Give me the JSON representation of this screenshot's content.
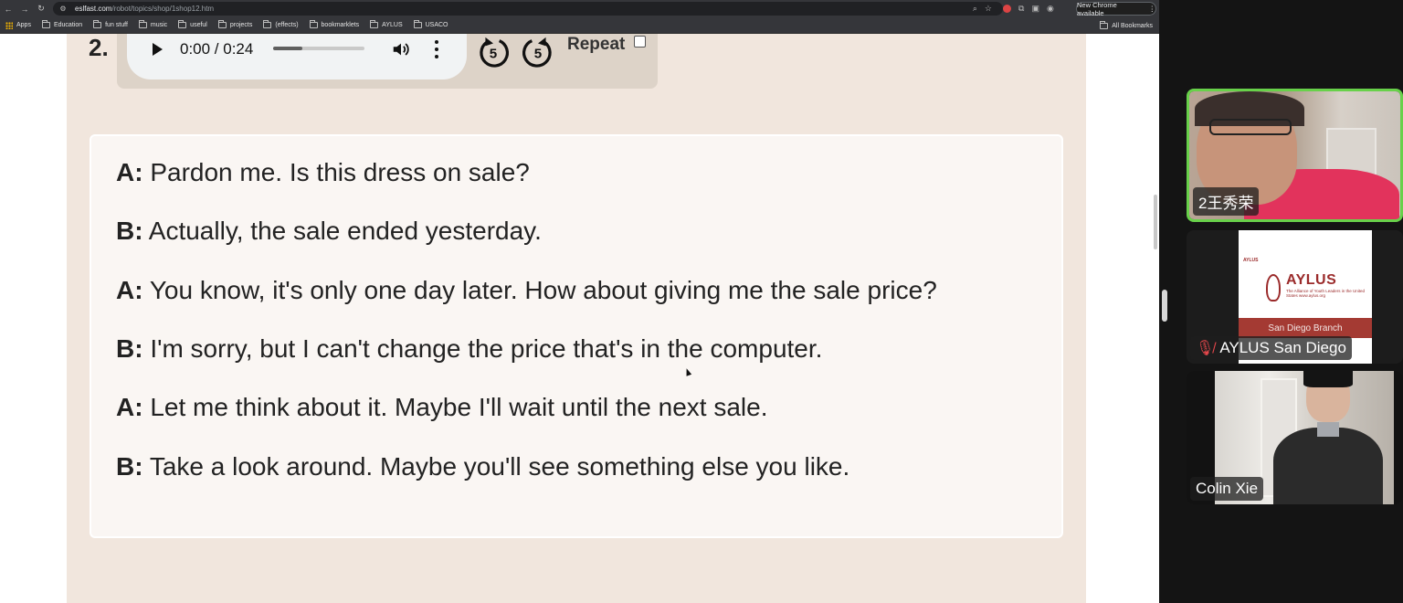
{
  "browser": {
    "url_host": "eslfast.com",
    "url_path": "/robot/topics/shop/1shop12.htm",
    "update_button": "New Chrome available",
    "bookmarks": [
      {
        "label": "Apps",
        "kind": "apps"
      },
      {
        "label": "Education",
        "kind": "folder"
      },
      {
        "label": "fun stuff",
        "kind": "folder"
      },
      {
        "label": "music",
        "kind": "folder"
      },
      {
        "label": "useful",
        "kind": "folder"
      },
      {
        "label": "projects",
        "kind": "folder"
      },
      {
        "label": "(effects)",
        "kind": "folder"
      },
      {
        "label": "bookmarklets",
        "kind": "folder"
      },
      {
        "label": "AYLUS",
        "kind": "folder"
      },
      {
        "label": "USACO",
        "kind": "folder"
      }
    ],
    "all_bookmarks": "All Bookmarks"
  },
  "exercise": {
    "number": "2.",
    "audio": {
      "time": "0:00 / 0:24",
      "progress_fraction": 0.32,
      "skip_back_label": "5",
      "skip_forward_label": "5",
      "repeat_label": "Repeat",
      "repeat_checked": false
    },
    "dialogue": [
      {
        "speaker": "A:",
        "text": " Pardon me. Is this dress on sale?"
      },
      {
        "speaker": "B:",
        "text": " Actually, the sale ended yesterday."
      },
      {
        "speaker": "A:",
        "text": " You know, it's only one day later. How about giving me the sale price?"
      },
      {
        "speaker": "B:",
        "text": " I'm sorry, but I can't change the price that's in the computer."
      },
      {
        "speaker": "A:",
        "text": " Let me think about it. Maybe I'll wait until the next sale."
      },
      {
        "speaker": "B:",
        "text": " Take a look around. Maybe you'll see something else you like."
      }
    ]
  },
  "participants": [
    {
      "name": "2王秀荣",
      "active_speaker": true,
      "muted": false
    },
    {
      "name": "AYLUS San Diego",
      "active_speaker": false,
      "muted": true,
      "slide": {
        "header": "AYLUS",
        "title": "AYLUS",
        "subtitle": "The Alliance of Youth Leaders in the United States",
        "side_text": "Leadership Integrity Innovation",
        "site": "www.aylus.org",
        "band": "San Diego Branch"
      }
    },
    {
      "name": "Colin Xie",
      "active_speaker": false,
      "muted": false
    }
  ],
  "colors": {
    "content_bg": "#f1e6dd",
    "card_bg": "#faf6f3",
    "active_speaker_border": "#68d14a",
    "aylus_red": "#9b2b2b"
  }
}
